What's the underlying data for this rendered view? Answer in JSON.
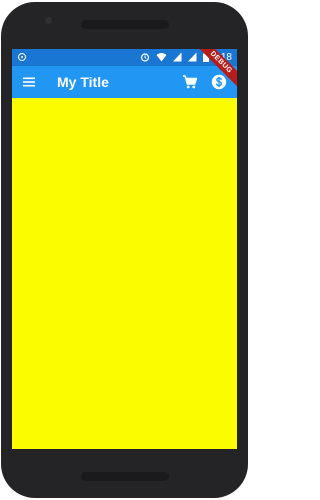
{
  "status_bar": {
    "time": "6:18",
    "icons": [
      "circle-notification-icon",
      "alarm-icon",
      "wifi-icon",
      "signal-icon",
      "signal-icon",
      "battery-icon"
    ]
  },
  "app_bar": {
    "title": "My Title",
    "leading_icon": "menu-icon",
    "actions": [
      "shopping-cart-icon",
      "dollar-coin-icon"
    ]
  },
  "debug_banner": {
    "label": "DEBUG"
  },
  "colors": {
    "status_bar": "#1976d2",
    "app_bar": "#2196f3",
    "body_background": "#fcfc00",
    "debug_banner": "#b71c1c",
    "device_frame": "#242427"
  }
}
